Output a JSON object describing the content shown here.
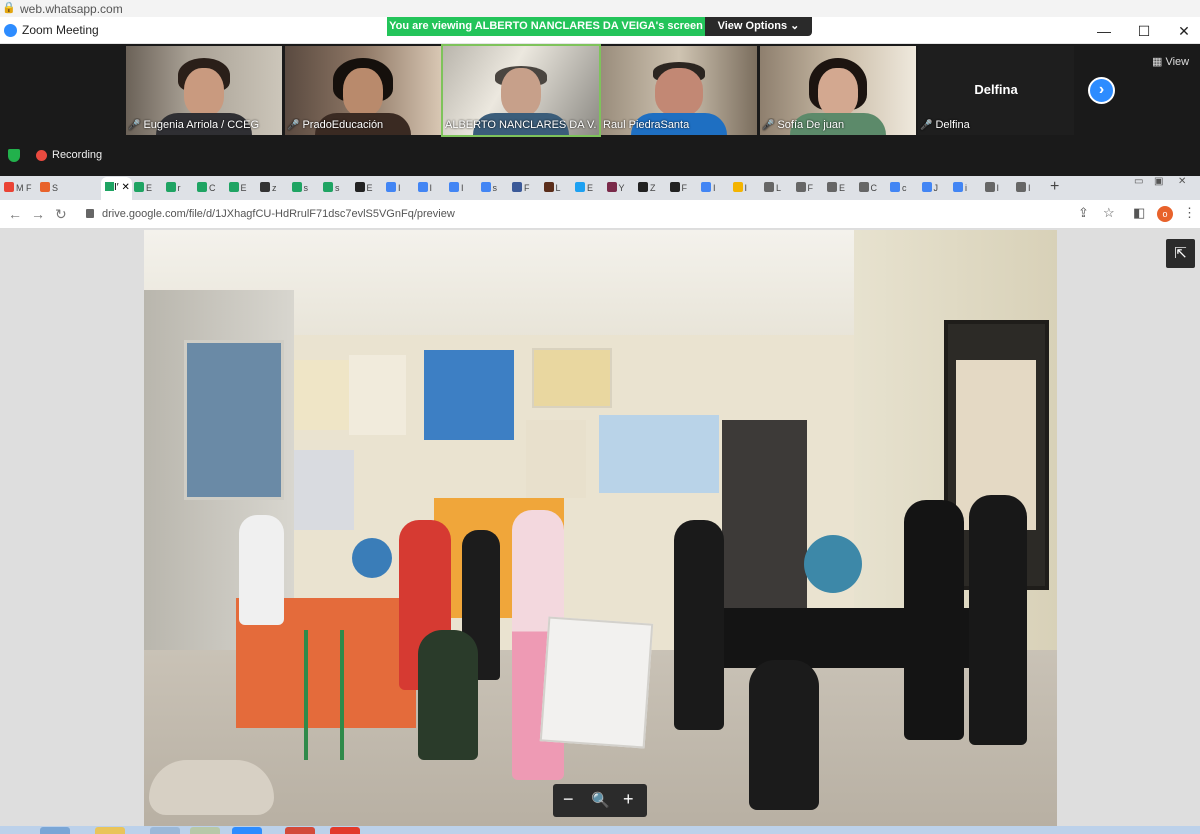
{
  "top_url": "web.whatsapp.com",
  "zoom": {
    "window_title": "Zoom Meeting",
    "banner": "You are viewing ALBERTO NANCLARES DA VEIGA's screen",
    "view_options": "View Options",
    "view_label": "View",
    "recording_label": "Recording",
    "participants": [
      {
        "name": "Eugenia Arriola / CCEG",
        "muted": true
      },
      {
        "name": "PradoEducación",
        "muted": true
      },
      {
        "name": "ALBERTO NANCLARES DA V...",
        "muted": false,
        "active": true
      },
      {
        "name": "Raul PiedraSanta",
        "muted": false
      },
      {
        "name": "Sofía De juan",
        "muted": true
      },
      {
        "name": "Delfina",
        "muted": true,
        "video": false
      }
    ],
    "delfina_display": "Delfina"
  },
  "browser": {
    "url": "drive.google.com/file/d/1JXhagfCU-HdRrulF71dsc7evlS5VGnFq/preview",
    "active_tab_label": "I′",
    "tabs": [
      {
        "label": "M F",
        "color": "#ea4335"
      },
      {
        "label": "S",
        "color": "#e8622b"
      },
      {
        "label": "E",
        "color": "#1fa463"
      },
      {
        "label": "r",
        "color": "#1fa463"
      },
      {
        "label": "C",
        "color": "#1fa463"
      },
      {
        "label": "E",
        "color": "#1fa463"
      },
      {
        "label": "z",
        "color": "#333333"
      },
      {
        "label": "s",
        "color": "#1fa463"
      },
      {
        "label": "s",
        "color": "#1fa463"
      },
      {
        "label": "E",
        "color": "#222222"
      },
      {
        "label": "I",
        "color": "#4285f4"
      },
      {
        "label": "I",
        "color": "#4285f4"
      },
      {
        "label": "I",
        "color": "#4285f4"
      },
      {
        "label": "s",
        "color": "#4285f4"
      },
      {
        "label": "F",
        "color": "#3b5998"
      },
      {
        "label": "L",
        "color": "#5a2d1a"
      },
      {
        "label": "E",
        "color": "#1da1f2"
      },
      {
        "label": "Y",
        "color": "#7a2a4a"
      },
      {
        "label": "Z",
        "color": "#222222"
      },
      {
        "label": "F",
        "color": "#222222"
      },
      {
        "label": "I",
        "color": "#4285f4"
      },
      {
        "label": "I",
        "color": "#f4b400"
      },
      {
        "label": "L",
        "color": "#666666"
      },
      {
        "label": "F",
        "color": "#666666"
      },
      {
        "label": "E",
        "color": "#666666"
      },
      {
        "label": "C",
        "color": "#666666"
      },
      {
        "label": "c",
        "color": "#4285f4"
      },
      {
        "label": "J",
        "color": "#4285f4"
      },
      {
        "label": "i",
        "color": "#4285f4"
      },
      {
        "label": "I",
        "color": "#666666"
      },
      {
        "label": "I",
        "color": "#666666"
      }
    ]
  },
  "colors": {
    "zoom_green": "#23c45a",
    "zoom_blue": "#2d8cff",
    "zoom_dark": "#1a1a1a",
    "recording_red": "#e94a3f"
  }
}
